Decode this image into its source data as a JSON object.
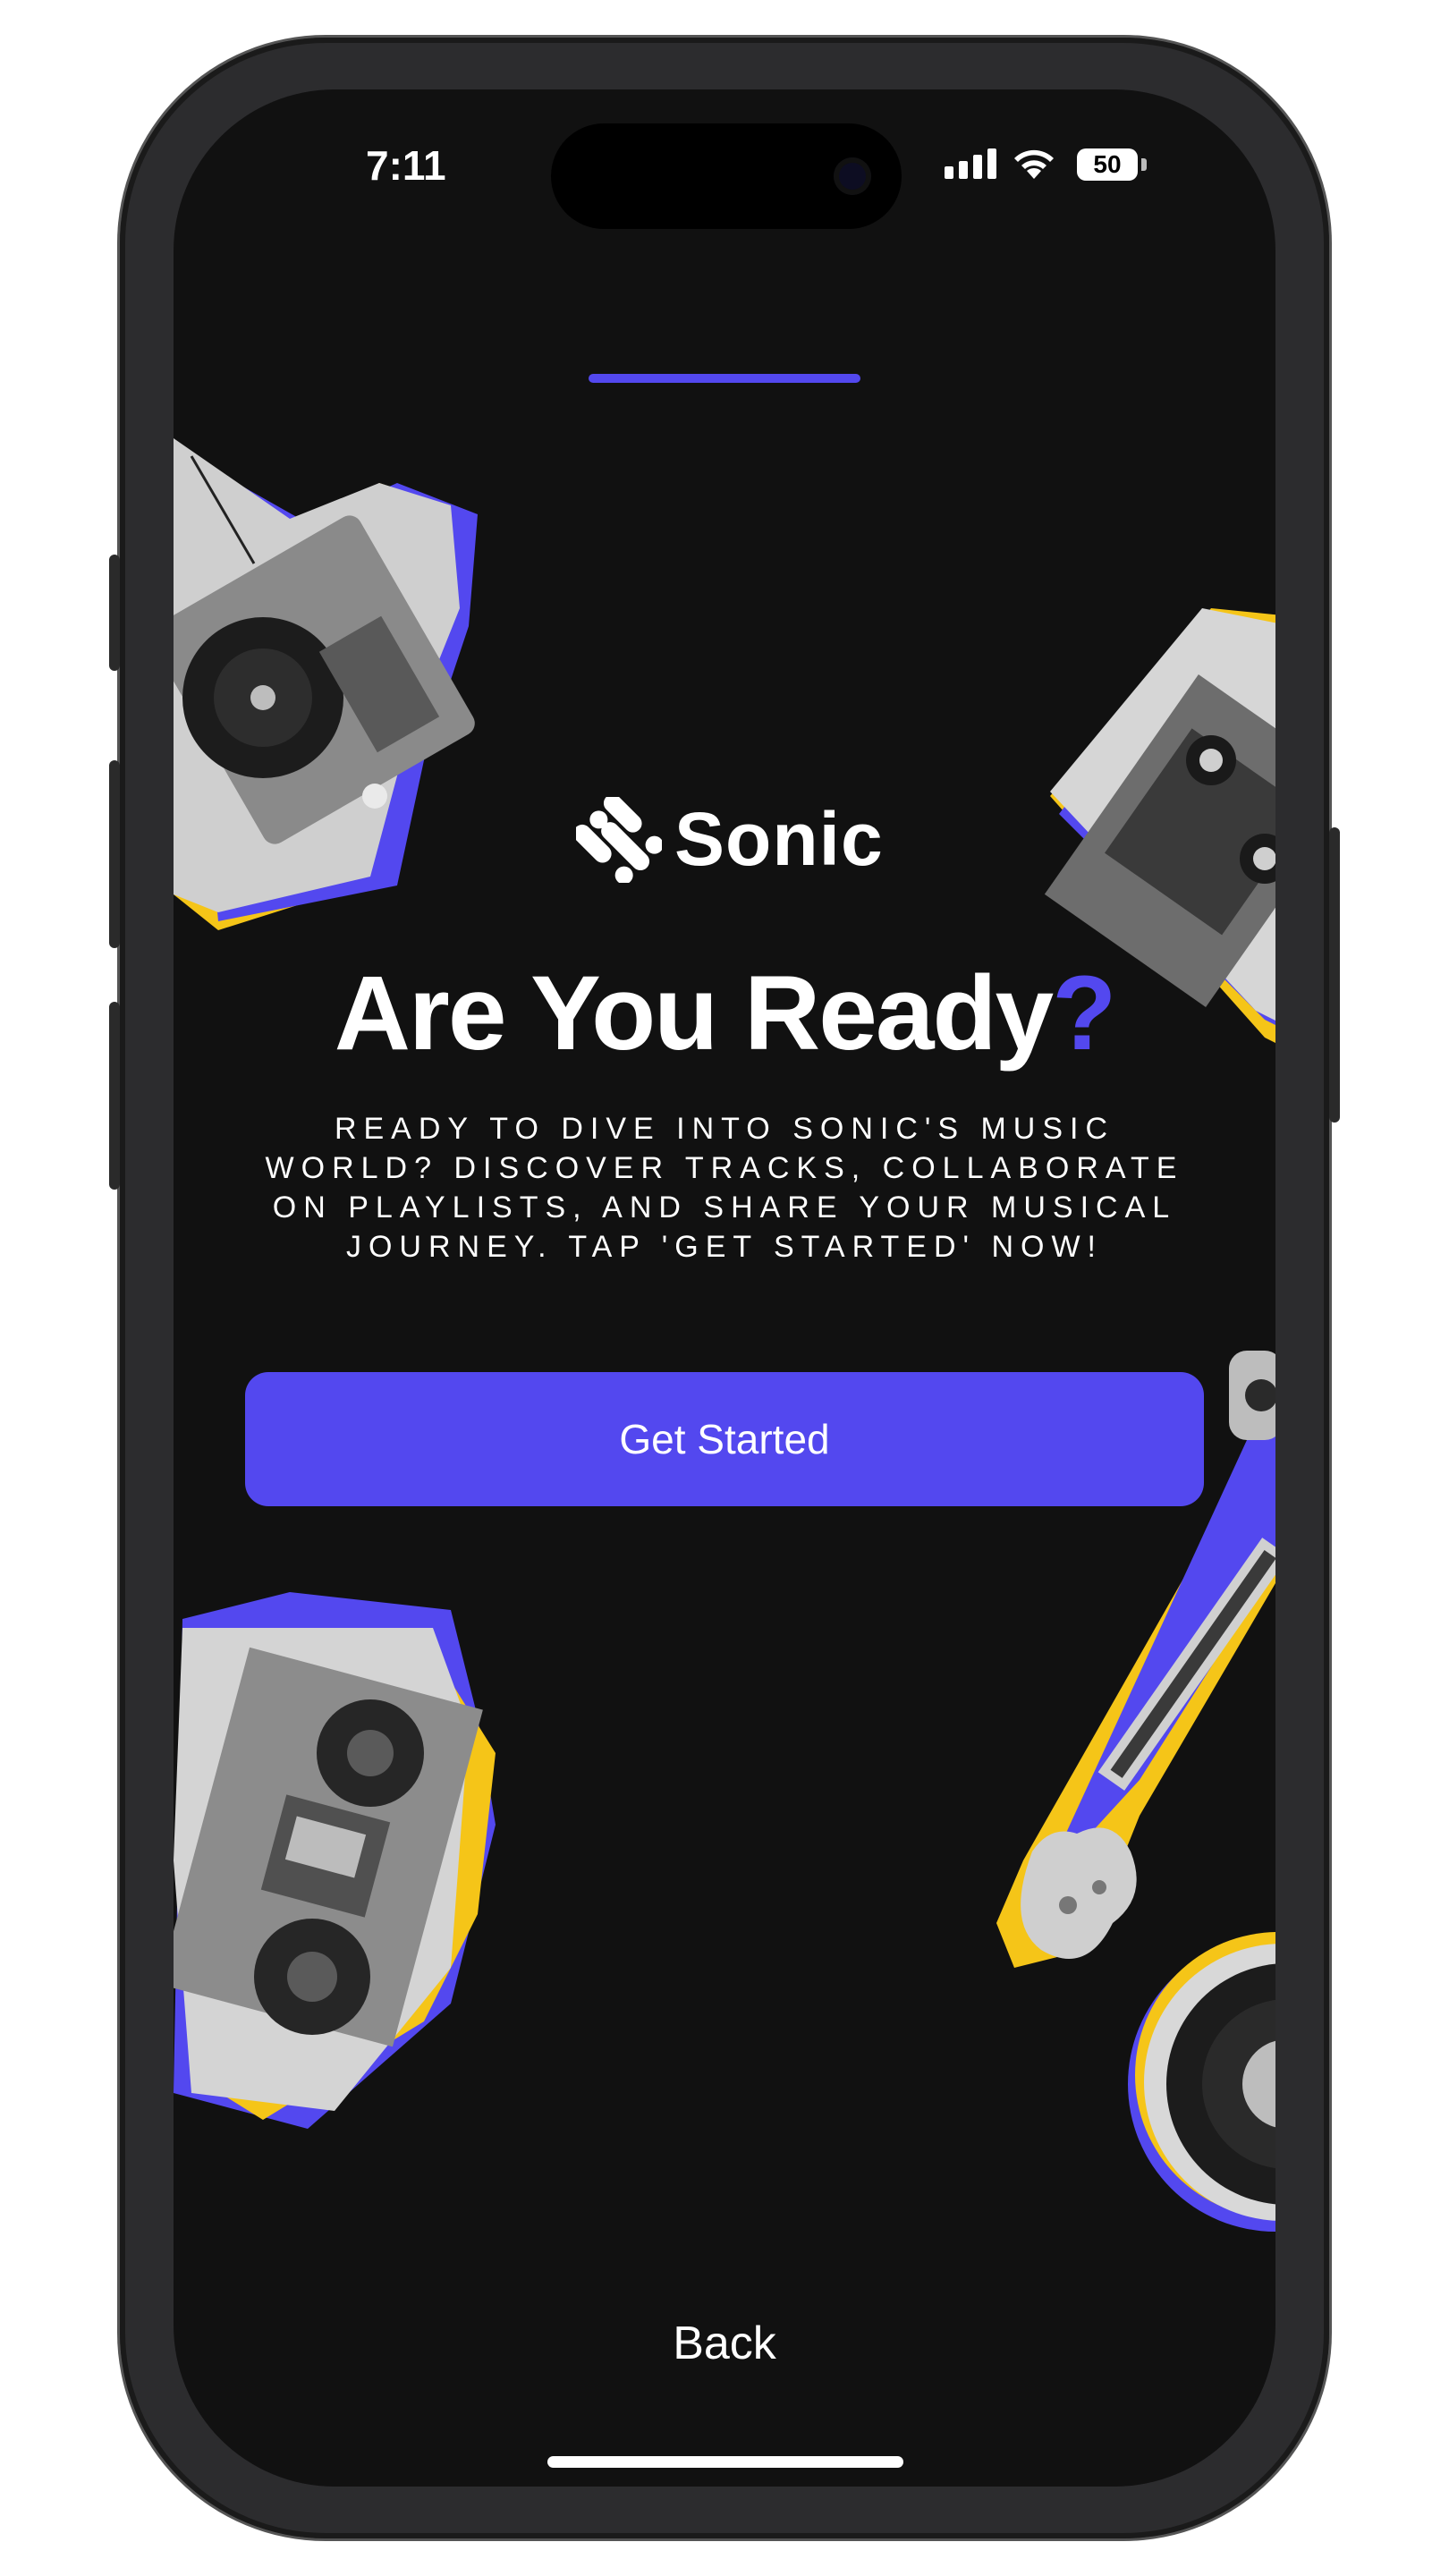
{
  "status_bar": {
    "time": "7:11",
    "battery": "50"
  },
  "brand": {
    "name": "Sonic",
    "accent_color": "#5348ef",
    "highlight_color": "#f5c518"
  },
  "onboarding": {
    "progress_fraction": 1.0,
    "headline": "Are You Ready",
    "headline_mark": "?",
    "description": "READY TO DIVE INTO SONIC'S MUSIC WORLD? DISCOVER TRACKS, COLLABORATE ON PLAYLISTS, AND SHARE YOUR MUSICAL JOURNEY. TAP 'GET STARTED' NOW!",
    "cta_label": "Get Started",
    "back_label": "Back"
  },
  "decorations": [
    "turntable-sticker",
    "cassette-sticker",
    "boombox-sticker",
    "guitar-sticker",
    "vinyl-record-sticker"
  ]
}
